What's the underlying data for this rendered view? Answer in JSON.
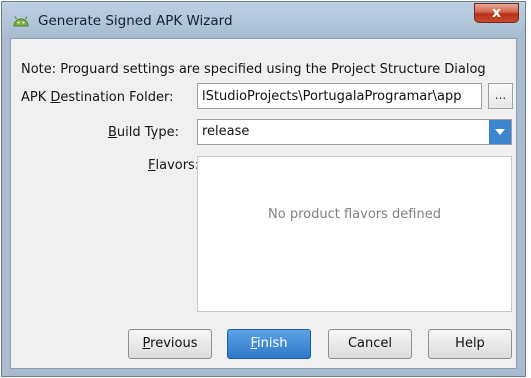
{
  "window": {
    "title": "Generate Signed APK Wizard",
    "close_symbol": "x"
  },
  "form": {
    "note": "Note: Proguard settings are specified using the Project Structure Dialog",
    "apk_label_pre": "APK ",
    "apk_label_mnemonic": "D",
    "apk_label_post": "estination Folder:",
    "apk_value": "lStudioProjects\\PortugalaProgramar\\app",
    "browse_label": "...",
    "build_label_mnemonic": "B",
    "build_label_post": "uild Type:",
    "build_value": "release",
    "flavors_label_mnemonic": "F",
    "flavors_label_post": "lavors:",
    "flavors_empty": "No product flavors defined"
  },
  "buttons": {
    "previous_mnemonic": "P",
    "previous_rest": "revious",
    "finish_mnemonic": "F",
    "finish_rest": "inish",
    "cancel": "Cancel",
    "help": "Help"
  },
  "colors": {
    "titlebar": "#b3c6da",
    "accent": "#3b86cf",
    "close": "#c84a2f"
  },
  "icons": [
    "android-icon",
    "close-icon",
    "chevron-down-icon"
  ]
}
